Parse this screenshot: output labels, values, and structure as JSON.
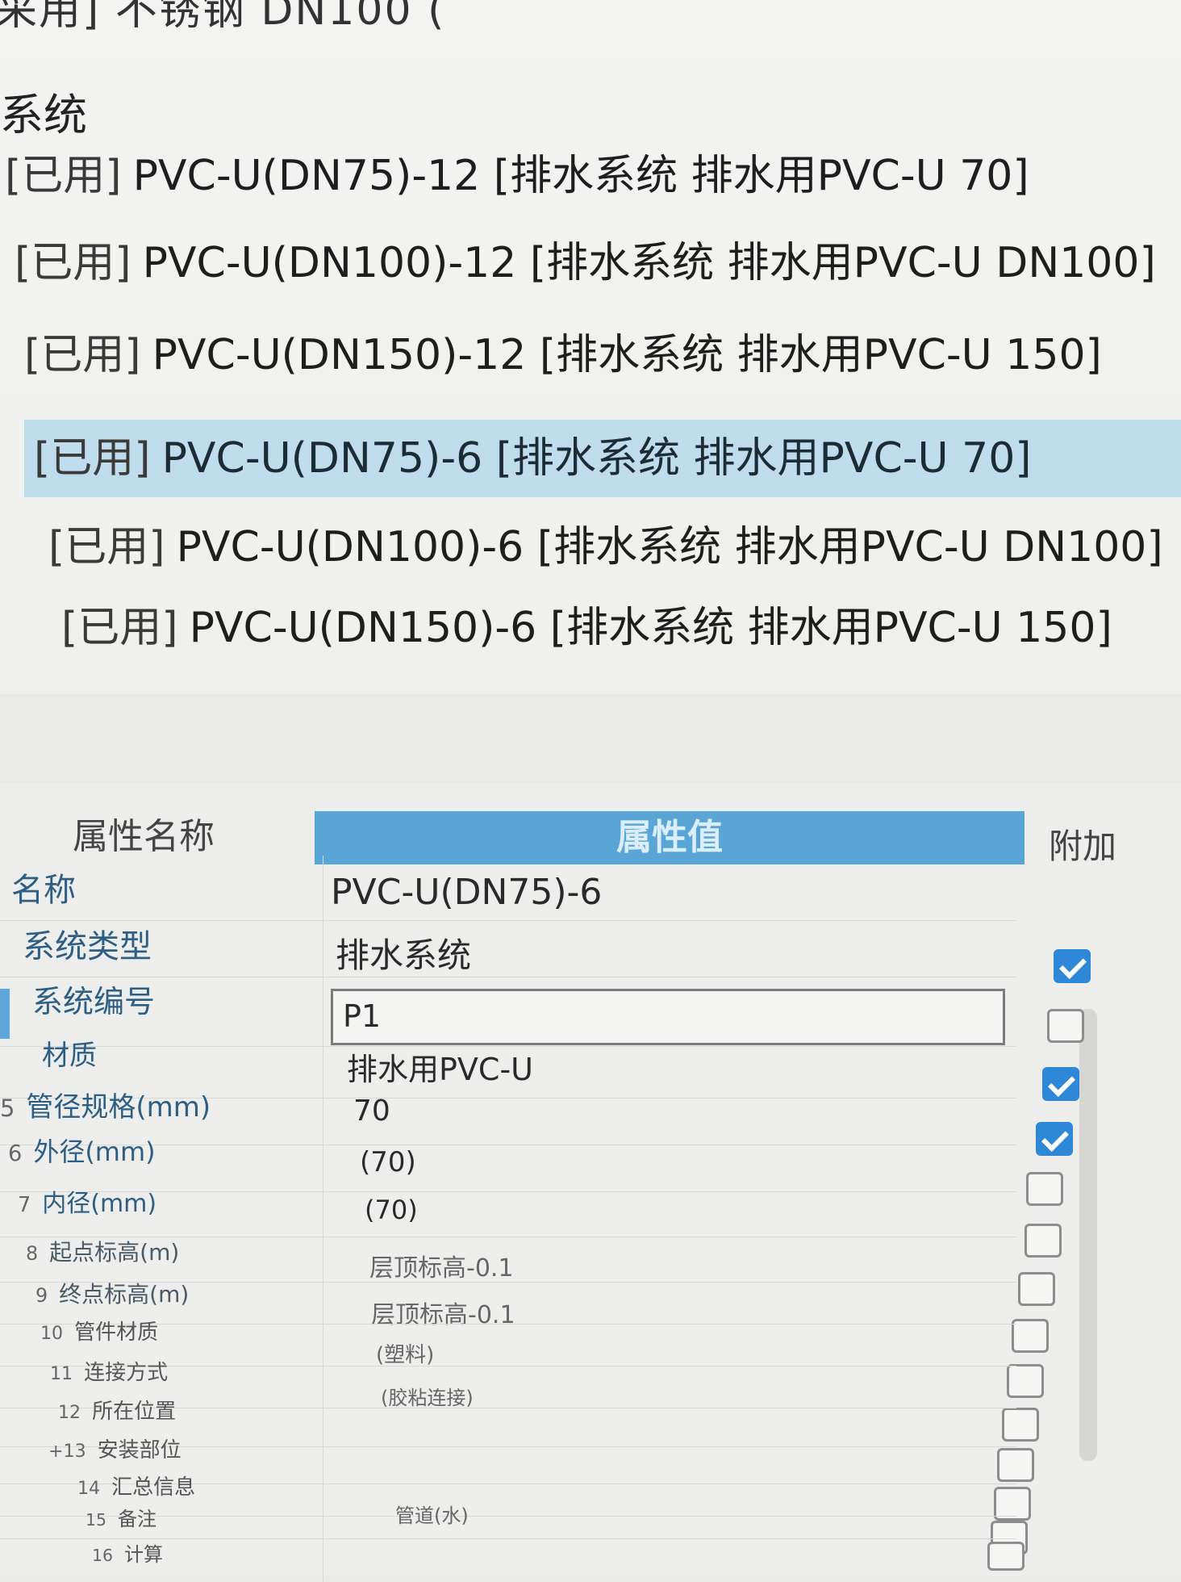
{
  "top_list": {
    "cutoff_text": "采用] 不锈钢 DN100 (",
    "group_label": "系统",
    "items": [
      {
        "tag": "[已用]",
        "text": "PVC-U(DN75)-12 [排水系统 排水用PVC-U 70]",
        "selected": false
      },
      {
        "tag": "[已用]",
        "text": "PVC-U(DN100)-12 [排水系统 排水用PVC-U DN100]",
        "selected": false
      },
      {
        "tag": "[已用]",
        "text": "PVC-U(DN150)-12 [排水系统 排水用PVC-U 150]",
        "selected": false
      },
      {
        "tag": "[已用]",
        "text": "PVC-U(DN75)-6 [排水系统 排水用PVC-U 70]",
        "selected": true
      },
      {
        "tag": "[已用]",
        "text": "PVC-U(DN100)-6 [排水系统 排水用PVC-U DN100]",
        "selected": false
      },
      {
        "tag": "[已用]",
        "text": "PVC-U(DN150)-6 [排水系统 排水用PVC-U 150]",
        "selected": false
      }
    ]
  },
  "props": {
    "headers": {
      "name": "属性名称",
      "value": "属性值",
      "attach": "附加"
    },
    "rows": [
      {
        "num": "",
        "name": "名称",
        "value": "PVC-U(DN75)-6",
        "checked": null
      },
      {
        "num": "",
        "name": "系统类型",
        "value": "排水系统",
        "checked": true
      },
      {
        "num": "",
        "name": "系统编号",
        "value": "P1",
        "checked": false
      },
      {
        "num": "",
        "name": "材质",
        "value": "排水用PVC-U",
        "checked": true
      },
      {
        "num": "5",
        "name": "管径规格(mm)",
        "value": "70",
        "checked": true
      },
      {
        "num": "6",
        "name": "外径(mm)",
        "value": "(70)",
        "checked": false
      },
      {
        "num": "7",
        "name": "内径(mm)",
        "value": "(70)",
        "checked": false
      },
      {
        "num": "8",
        "name": "起点标高(m)",
        "value": "层顶标高-0.1",
        "checked": false
      },
      {
        "num": "9",
        "name": "终点标高(m)",
        "value": "层顶标高-0.1",
        "checked": false
      },
      {
        "num": "10",
        "name": "管件材质",
        "value": "(塑料)",
        "checked": false
      },
      {
        "num": "11",
        "name": "连接方式",
        "value": "(胶粘连接)",
        "checked": false
      },
      {
        "num": "12",
        "name": "所在位置",
        "value": "",
        "checked": false
      },
      {
        "num": "+13",
        "name": "安装部位",
        "value": "",
        "checked": false
      },
      {
        "num": "14",
        "name": "汇总信息",
        "value": "",
        "checked": false
      },
      {
        "num": "15",
        "name": "备注",
        "value": "管道(水)",
        "checked": false
      },
      {
        "num": "16",
        "name": "计算",
        "value": "",
        "checked": false
      }
    ]
  }
}
